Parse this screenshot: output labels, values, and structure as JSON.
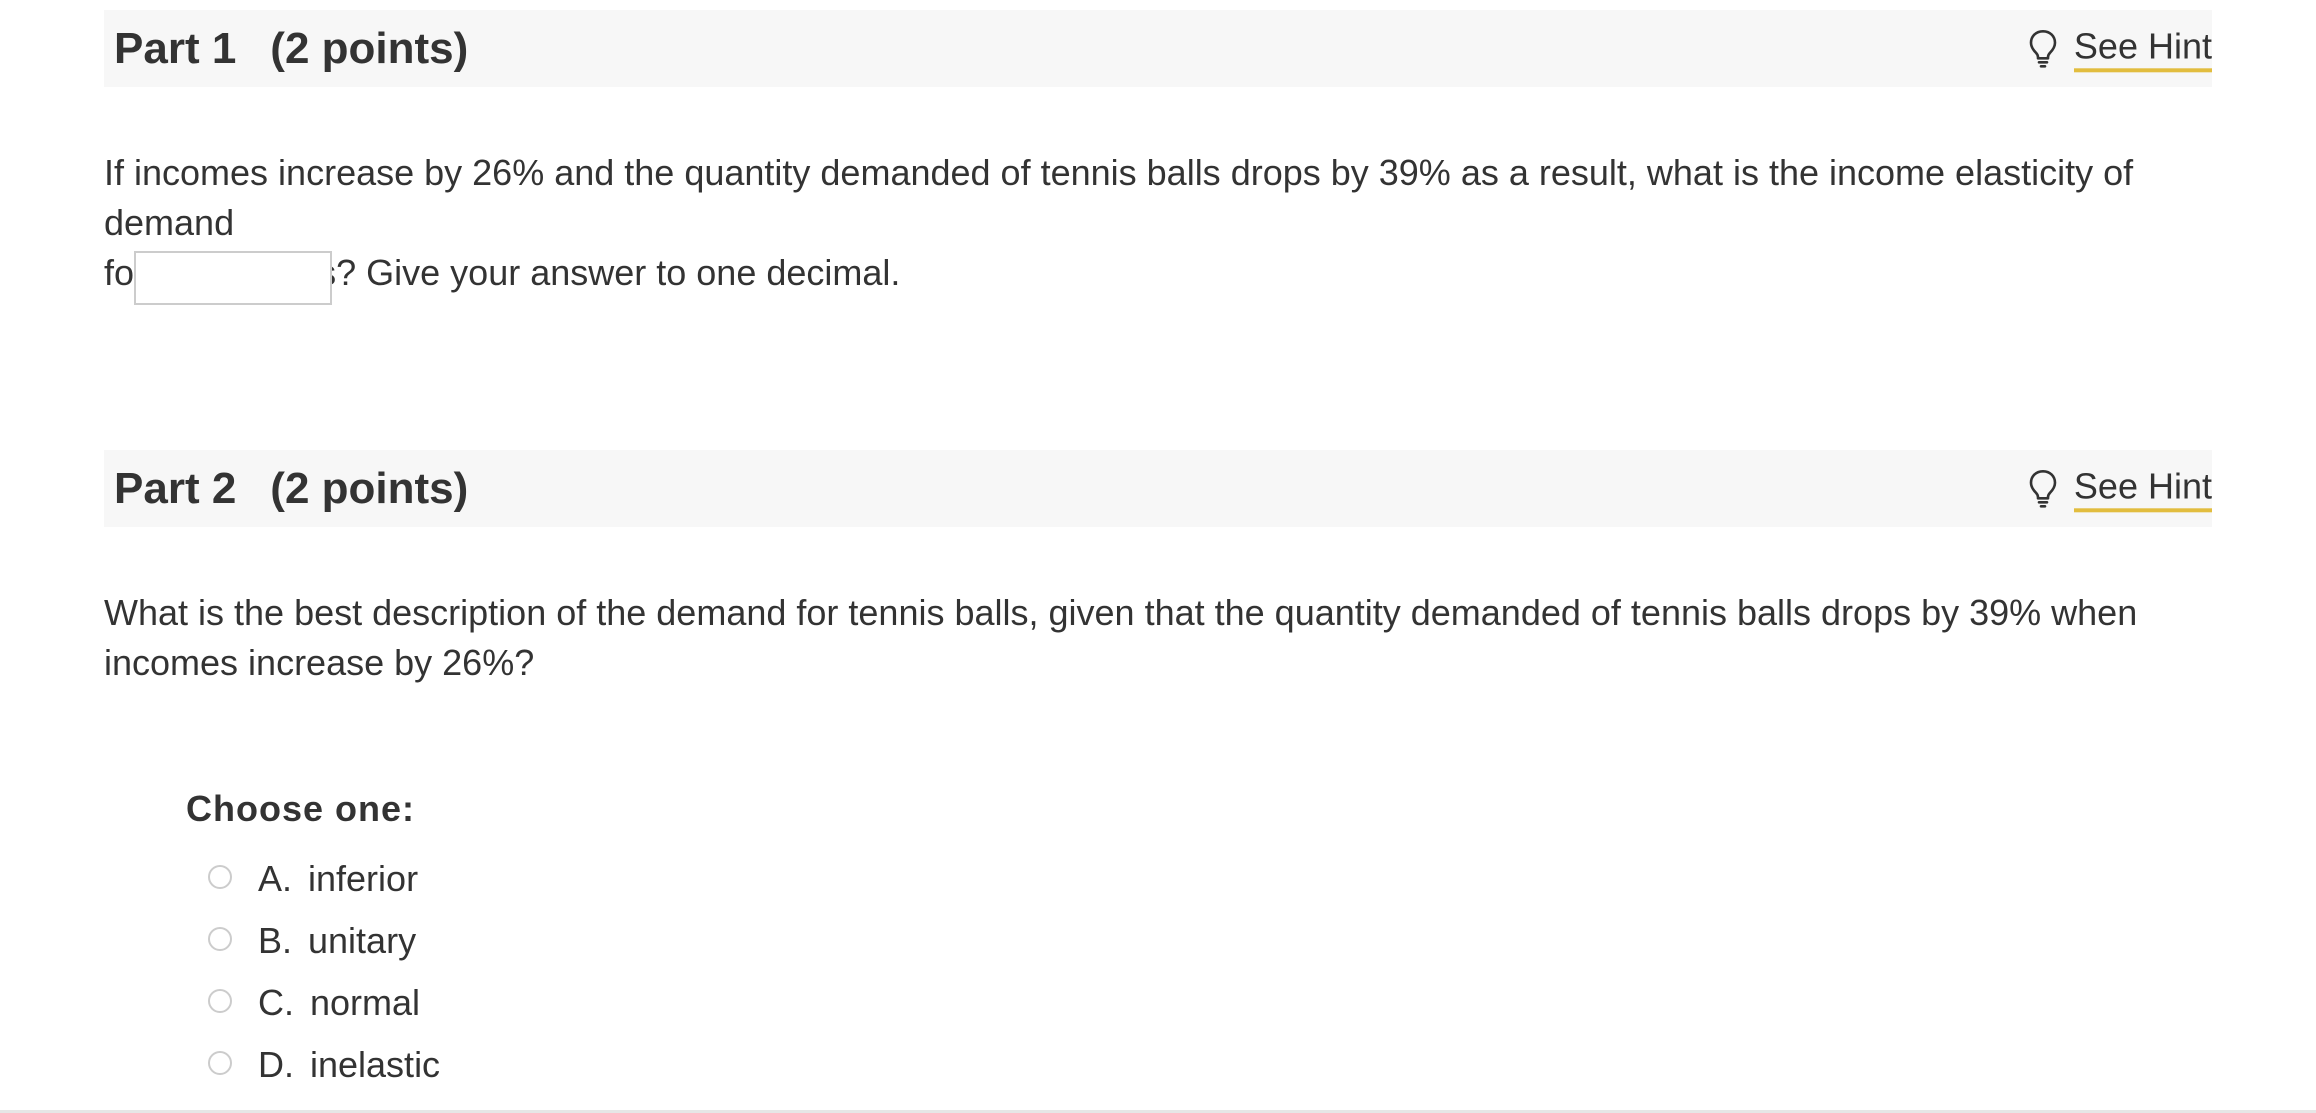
{
  "part1": {
    "title": "Part 1",
    "points": "(2 points)",
    "hint_label": "See Hint",
    "question_line1": "If incomes increase by 26% and the quantity demanded of tennis balls drops by 39% as a result, what is the income elasticity of demand",
    "question_line2": "for tennis balls? Give your answer to one decimal.",
    "answer_value": ""
  },
  "part2": {
    "title": "Part 2",
    "points": "(2 points)",
    "hint_label": "See Hint",
    "question_line1": "What is the best description of the demand for tennis balls, given that the quantity demanded of tennis balls drops by 39% when",
    "question_line2": "incomes increase by 26%?",
    "choose_label": "Choose one:",
    "choices": [
      {
        "letter": "A.",
        "text": "inferior"
      },
      {
        "letter": "B.",
        "text": "unitary"
      },
      {
        "letter": "C.",
        "text": "normal"
      },
      {
        "letter": "D.",
        "text": "inelastic"
      }
    ]
  },
  "icons": {
    "hint": "lightbulb-icon"
  },
  "colors": {
    "header_bg": "#f7f7f7",
    "hint_underline": "#e2bd3e",
    "text": "#333333"
  }
}
